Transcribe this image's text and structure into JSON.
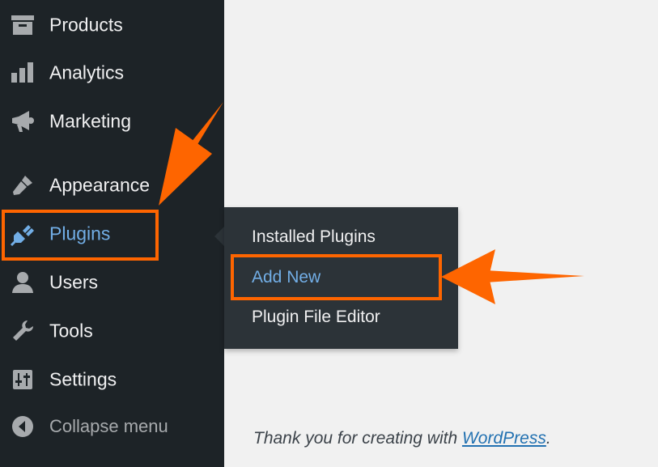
{
  "menu": {
    "items": [
      {
        "id": "products",
        "label": "Products",
        "icon": "archive-icon"
      },
      {
        "id": "analytics",
        "label": "Analytics",
        "icon": "bar-chart-icon"
      },
      {
        "id": "marketing",
        "label": "Marketing",
        "icon": "megaphone-icon"
      },
      {
        "id": "appearance",
        "label": "Appearance",
        "icon": "paintbrush-icon"
      },
      {
        "id": "plugins",
        "label": "Plugins",
        "icon": "plug-icon",
        "active": true
      },
      {
        "id": "users",
        "label": "Users",
        "icon": "user-icon"
      },
      {
        "id": "tools",
        "label": "Tools",
        "icon": "wrench-icon"
      },
      {
        "id": "settings",
        "label": "Settings",
        "icon": "sliders-icon"
      }
    ],
    "collapse_label": "Collapse menu",
    "collapse_icon": "collapse-arrow-icon"
  },
  "submenu": {
    "items": [
      {
        "label": "Installed Plugins"
      },
      {
        "label": "Add New",
        "current": true
      },
      {
        "label": "Plugin File Editor"
      }
    ]
  },
  "footer": {
    "text_before": "Thank you for creating with ",
    "link_text": "WordPress",
    "text_after": "."
  },
  "colors": {
    "sidebar_bg": "#1d2327",
    "submenu_bg": "#2c3338",
    "active_text": "#72aee6",
    "highlight_orange": "#fe6500",
    "content_bg": "#f1f1f1",
    "link": "#2271b1"
  }
}
